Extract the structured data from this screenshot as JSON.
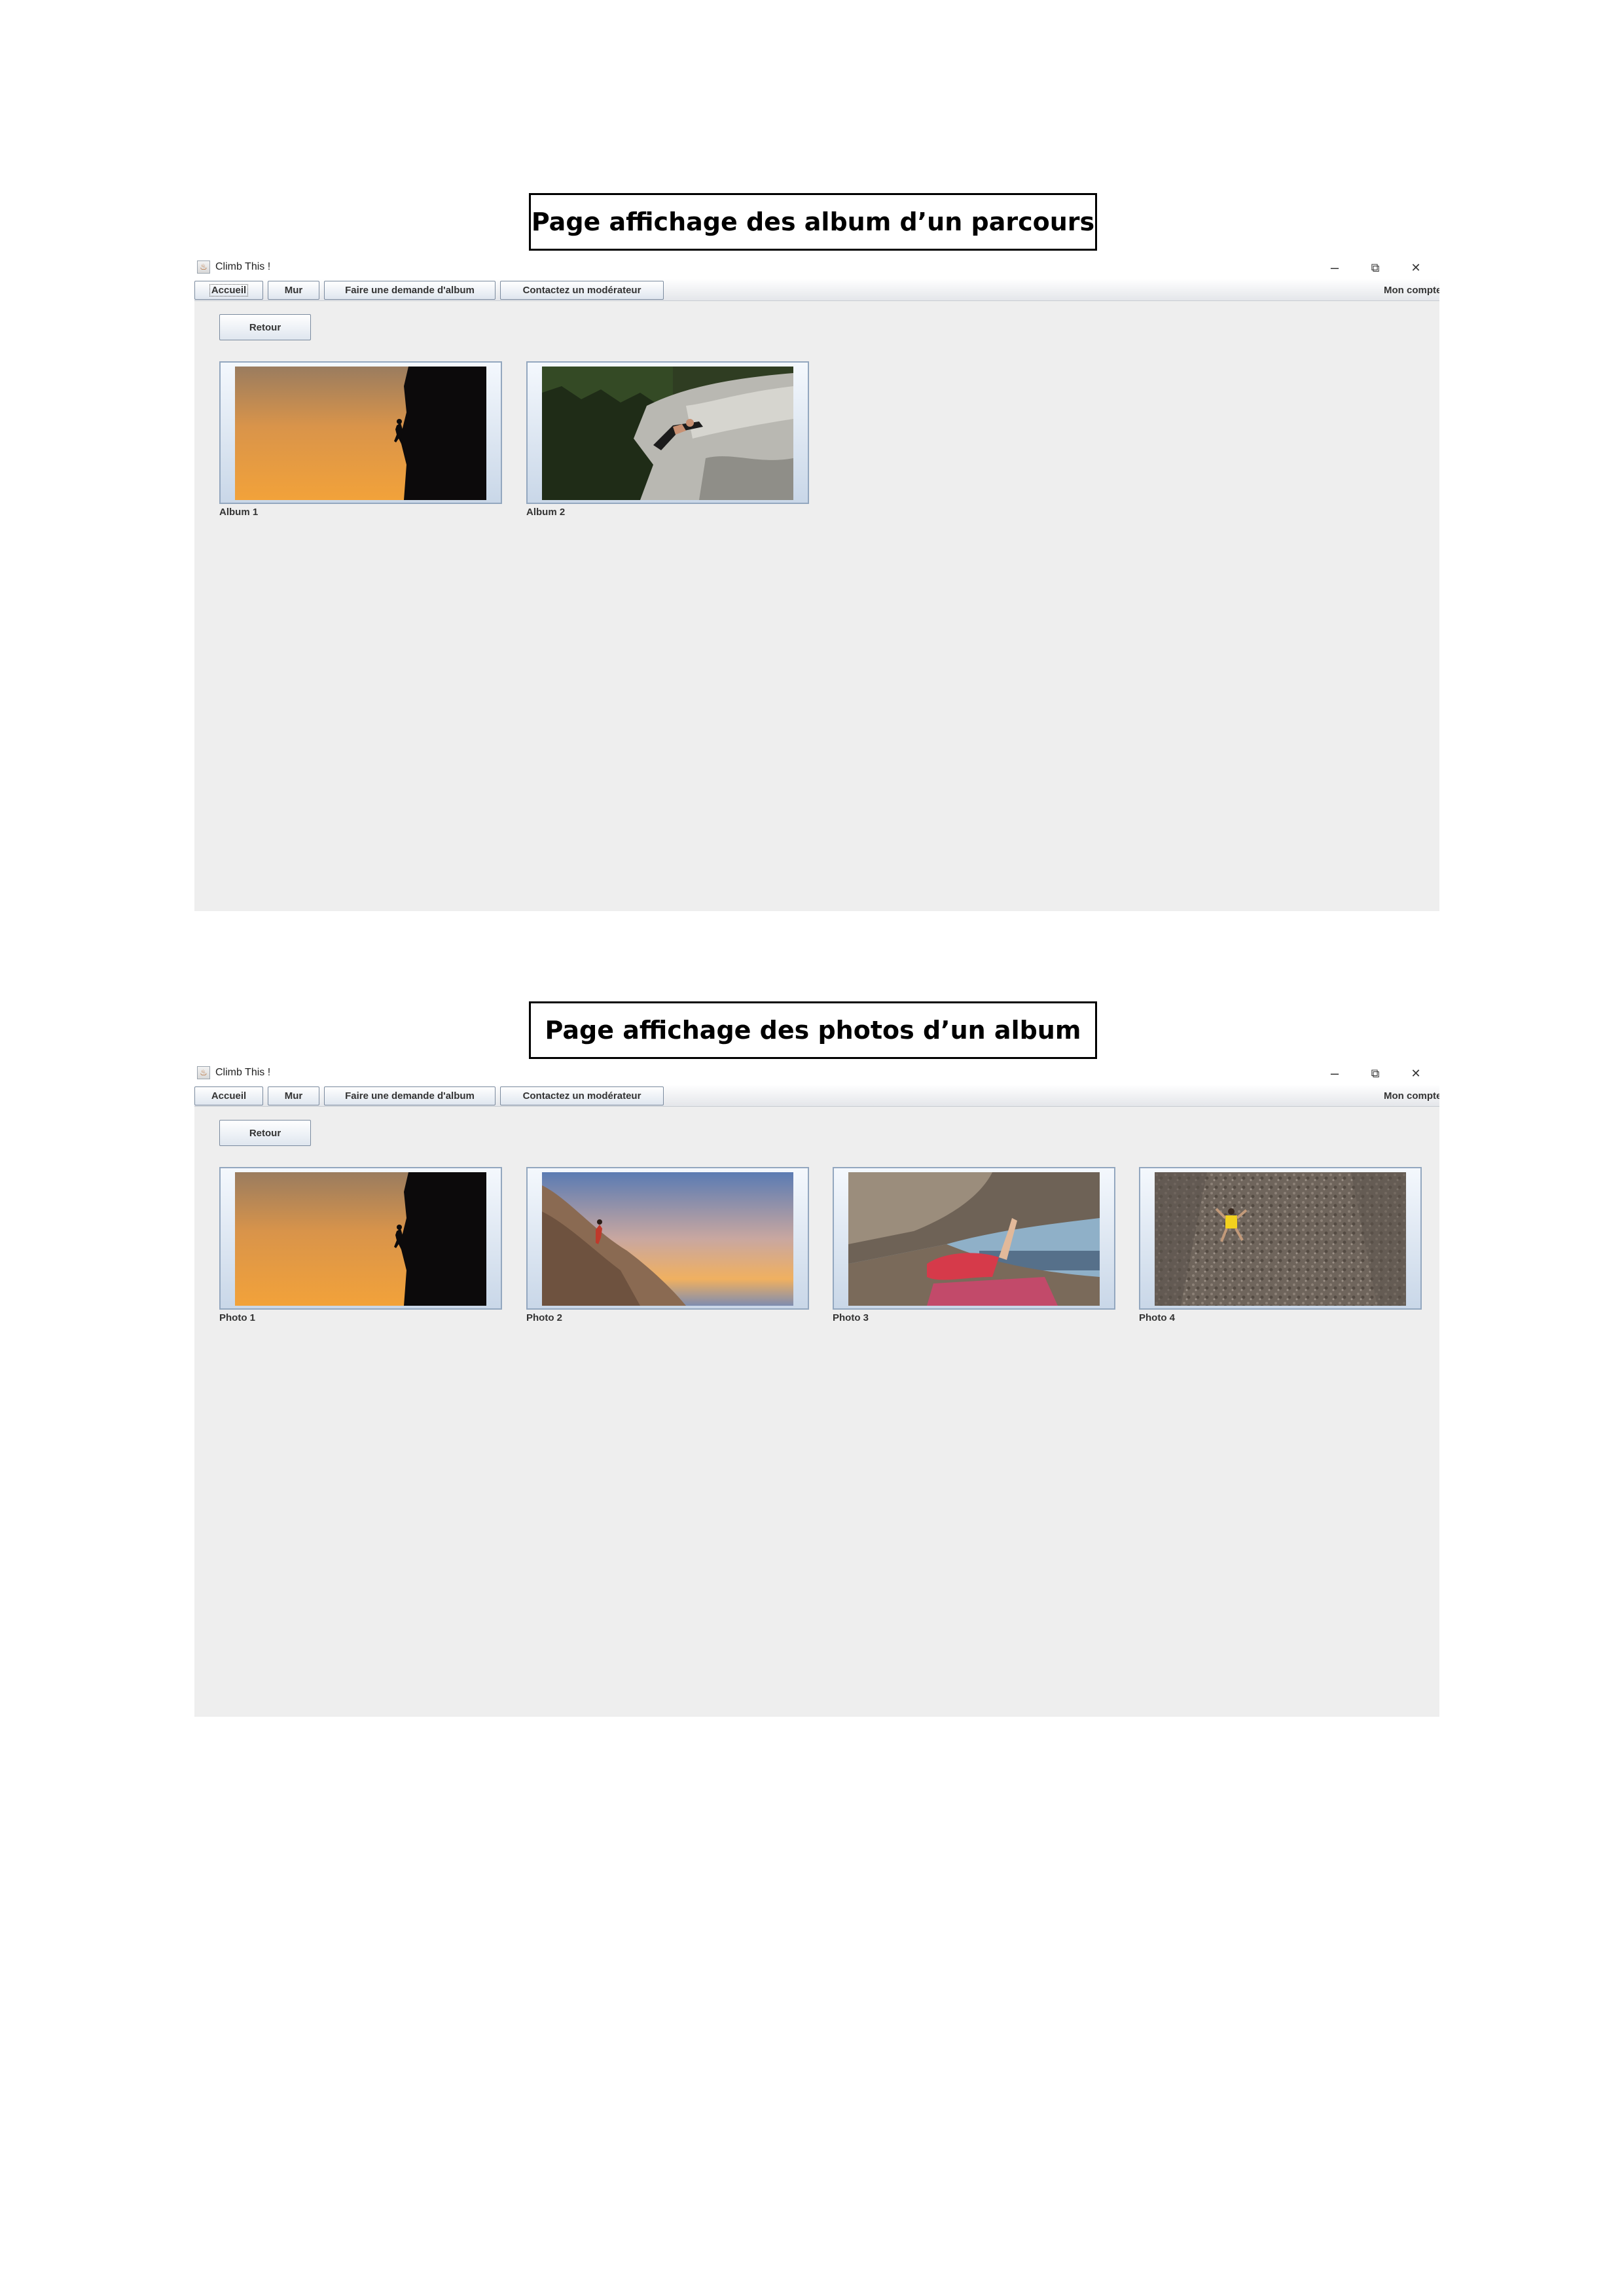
{
  "sections": [
    {
      "caption": "Page affichage des album d’un parcours",
      "window": {
        "title": "Climb This !",
        "controls": {
          "minimize": "–",
          "restore": "⧉",
          "close": "✕"
        },
        "menu": [
          "Accueil",
          "Mur",
          "Faire une demande d'album",
          "Contactez un modérateur"
        ],
        "account": "Mon compte",
        "back": "Retour",
        "items": [
          {
            "label": "Album 1",
            "image": "sunset-climber-silhouette"
          },
          {
            "label": "Album 2",
            "image": "climber-on-rock-forest"
          }
        ]
      }
    },
    {
      "caption": "Page affichage des photos d’un album",
      "window": {
        "title": "Climb This !",
        "controls": {
          "minimize": "–",
          "restore": "⧉",
          "close": "✕"
        },
        "menu": [
          "Accueil",
          "Mur",
          "Faire une demande d'album",
          "Contactez un modérateur"
        ],
        "account": "Mon compte",
        "back": "Retour",
        "items": [
          {
            "label": "Photo 1",
            "image": "sunset-climber-silhouette"
          },
          {
            "label": "Photo 2",
            "image": "climber-on-slab-sunset"
          },
          {
            "label": "Photo 3",
            "image": "climber-under-roof"
          },
          {
            "label": "Photo 4",
            "image": "climber-on-granite-wall"
          }
        ]
      }
    }
  ]
}
